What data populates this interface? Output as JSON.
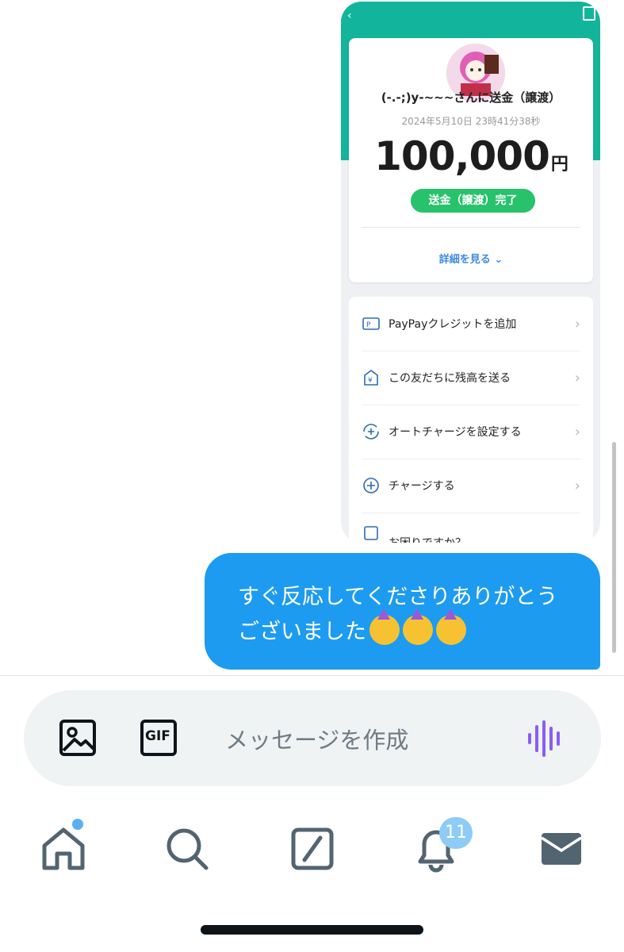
{
  "receipt": {
    "title": "(-.-;)y-~~~さんに送金（譲渡）",
    "datetime": "2024年5月10日 23時41分38秒",
    "amount": "100,000",
    "currency": "円",
    "status": "送金（譲渡）完了",
    "details_link": "詳細を見る"
  },
  "menu": [
    {
      "label": "PayPayクレジットを追加",
      "icon": "paypay-card-icon"
    },
    {
      "label": "この友だちに残高を送る",
      "icon": "yen-send-icon"
    },
    {
      "label": "オートチャージを設定する",
      "icon": "auto-charge-icon"
    },
    {
      "label": "チャージする",
      "icon": "plus-circle-icon"
    },
    {
      "label": "お困りですか？",
      "icon": "help-icon"
    }
  ],
  "message": {
    "text": "すぐ反応してくださりありがとうございました",
    "emoji_count": 3
  },
  "composer": {
    "placeholder": "メッセージを作成",
    "gif_label": "GIF"
  },
  "tabbar": {
    "notifications_badge": "11"
  },
  "colors": {
    "bubble": "#1d9bf0",
    "paypay_teal": "#12b59b",
    "status_green": "#27c26b",
    "voice_icon": "#8b5cf6"
  }
}
